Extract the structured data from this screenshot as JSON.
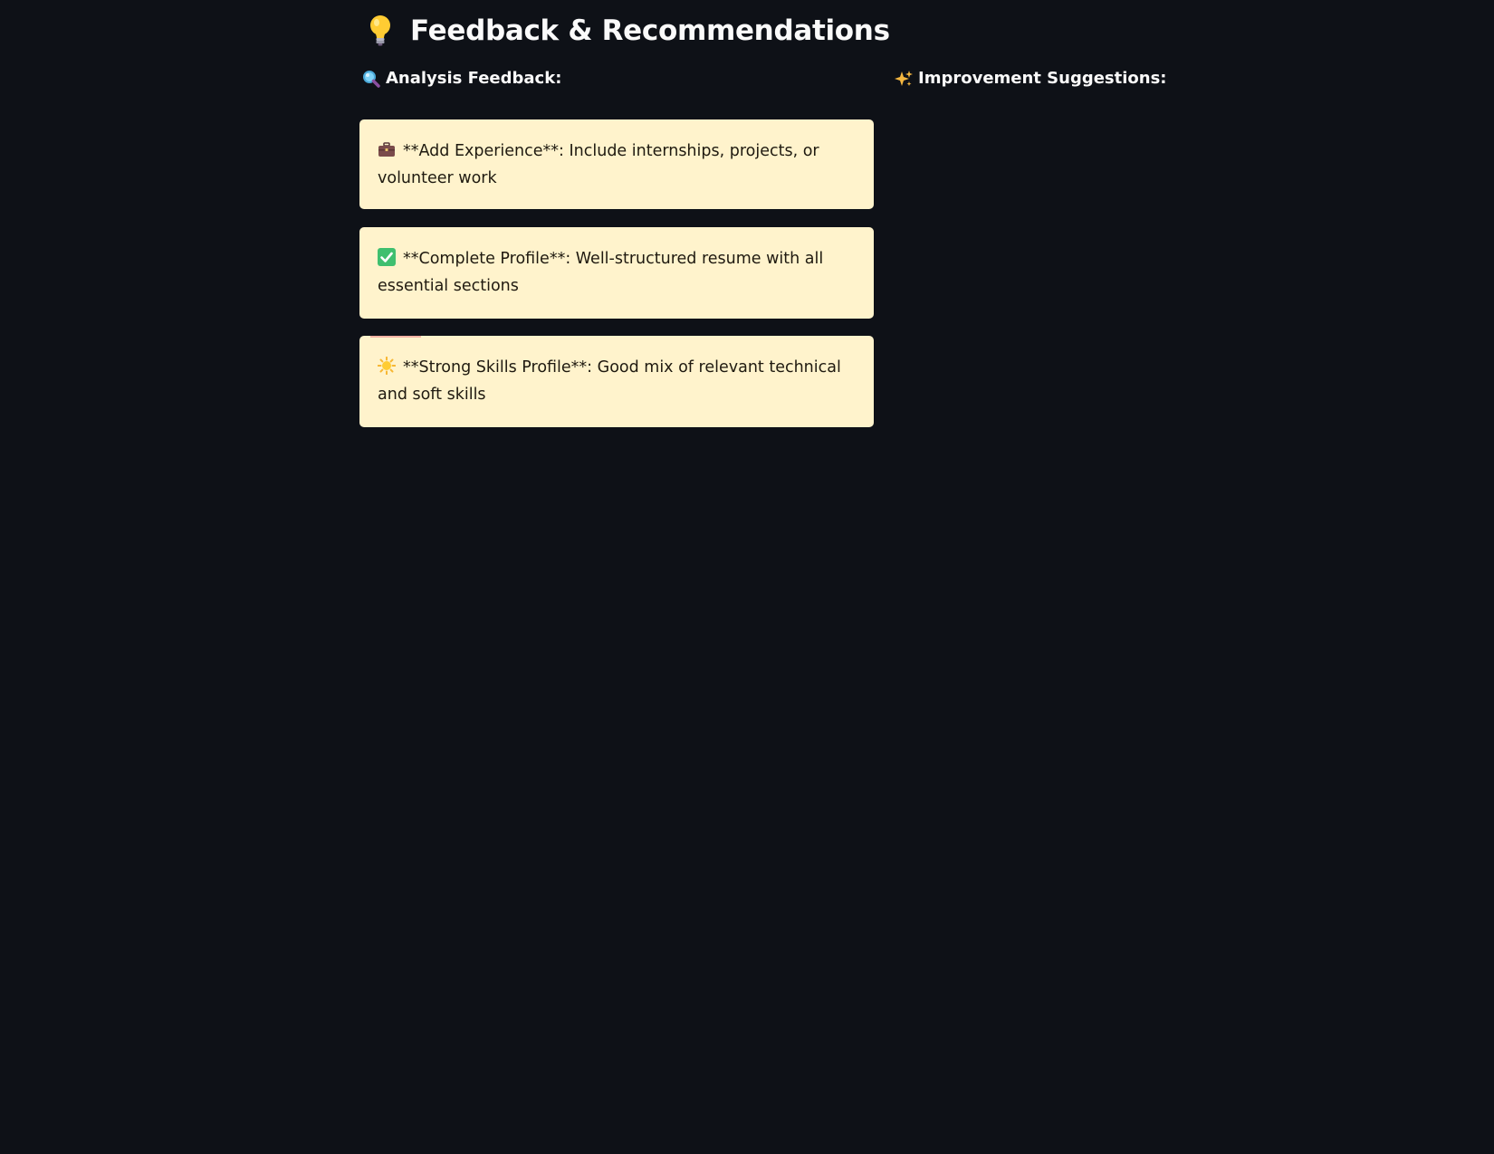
{
  "header": {
    "title": "Feedback & Recommendations",
    "title_icon": "lightbulb-icon"
  },
  "columns": {
    "analysis": {
      "label": "Analysis Feedback:",
      "icon": "magnifier-icon"
    },
    "improvement": {
      "label": "Improvement Suggestions:",
      "icon": "sparkles-icon"
    }
  },
  "feedback_cards": [
    {
      "icon": "briefcase-icon",
      "text": "**Add Experience**: Include internships, projects, or volunteer work"
    },
    {
      "icon": "check-box-icon",
      "text": "**Complete Profile**: Well-structured resume with all essential sections"
    },
    {
      "icon": "sun-icon",
      "text": "**Strong Skills Profile**: Good mix of relevant technical and soft skills"
    }
  ],
  "colors": {
    "background": "#0e1117",
    "card_background": "#fff3cc",
    "text_light": "#fafafa",
    "text_dark": "#1f1a10"
  }
}
